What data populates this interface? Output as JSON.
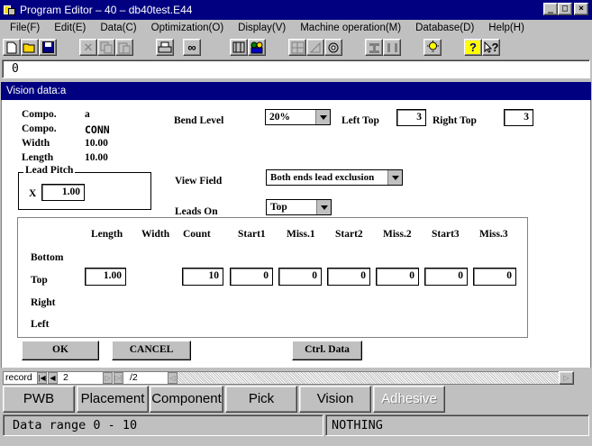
{
  "window": {
    "title": "Program Editor – 40 – db40test.E44",
    "minimize": "_",
    "maximize": "□",
    "close": "×"
  },
  "menu": [
    "File(F)",
    "Edit(E)",
    "Data(C)",
    "Optimization(O)",
    "Display(V)",
    "Machine operation(M)",
    "Database(D)",
    "Help(H)"
  ],
  "toolbar": {
    "icons": [
      "new-icon",
      "open-icon",
      "save-icon",
      "cut-icon",
      "copy-icon",
      "paste-icon",
      "print-icon",
      "glasses-icon",
      "machine-icon",
      "people-icon",
      "grid-icon",
      "drafting-icon",
      "conveyor-icon",
      "align-icon",
      "bar-icon",
      "lightbulb-icon",
      "help-icon",
      "context-help-icon"
    ],
    "help_glyph": "?",
    "context_help_glyph": "?"
  },
  "edit_line": {
    "value": "0"
  },
  "dialog": {
    "title": "Vision data:a",
    "compo_label_1": "Compo.",
    "compo_value_1": "a",
    "compo_label_2": "Compo.",
    "compo_value_2": "CONN",
    "width_label": "Width",
    "width_value": "10.00",
    "length_label": "Length",
    "length_value": "10.00",
    "lead_pitch": {
      "title": "Lead Pitch",
      "x_label": "X",
      "x_value": "1.00"
    },
    "bend_level": {
      "label": "Bend Level",
      "value": "20%"
    },
    "left_top": {
      "label": "Left Top",
      "value": "3"
    },
    "right_top": {
      "label": "Right Top",
      "value": "3"
    },
    "view_field": {
      "label": "View Field",
      "value": "Both ends lead exclusion"
    },
    "leads_on": {
      "label": "Leads On",
      "value": "Top"
    },
    "grid": {
      "columns": [
        "Length",
        "Width",
        "Count",
        "Start1",
        "Miss.1",
        "Start2",
        "Miss.2",
        "Start3",
        "Miss.3"
      ],
      "rows": [
        "Bottom",
        "Top",
        "Right",
        "Left"
      ],
      "top_values": {
        "length": "1.00",
        "count": "10",
        "start1": "0",
        "miss1": "0",
        "start2": "0",
        "miss2": "0",
        "start3": "0",
        "miss3": "0"
      }
    },
    "buttons": {
      "ok": "OK",
      "cancel": "CANCEL",
      "ctrl": "Ctrl. Data"
    }
  },
  "record": {
    "label": "record",
    "current": "2",
    "total": "/2"
  },
  "tabs": [
    {
      "label": "PWB",
      "enabled": true
    },
    {
      "label": "Placement",
      "enabled": true
    },
    {
      "label": "Component",
      "enabled": true
    },
    {
      "label": "Pick",
      "enabled": true
    },
    {
      "label": "Vision",
      "enabled": true
    },
    {
      "label": "Adhesive",
      "enabled": false
    }
  ],
  "status": {
    "left": "Data range 0 - 10",
    "right": "NOTHING"
  }
}
